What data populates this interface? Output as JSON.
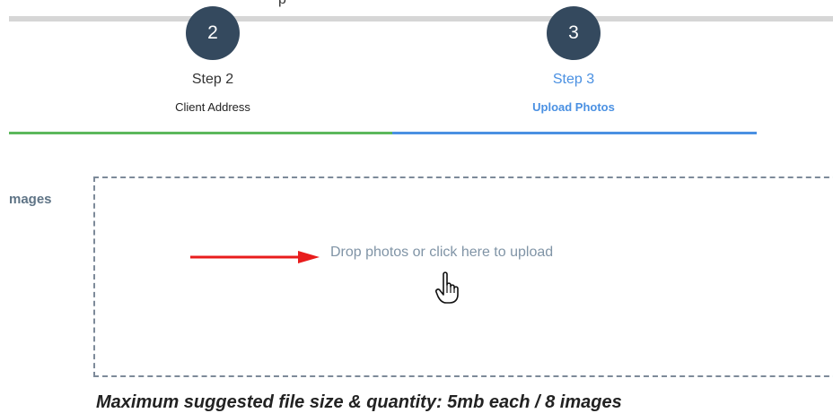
{
  "header": {
    "top_fragment": "p"
  },
  "steps": [
    {
      "number": "2",
      "title": "Step 2",
      "subtitle": "Client Address",
      "state": "done"
    },
    {
      "number": "3",
      "title": "Step 3",
      "subtitle": "Upload Photos",
      "state": "active"
    }
  ],
  "colors": {
    "step_circle": "#34495e",
    "done": "#5cb85c",
    "active": "#4a90e2",
    "arrow": "#e81c1c"
  },
  "upload": {
    "label": "mages",
    "dropzone_text": "Drop photos or click here to upload",
    "hint": "Maximum suggested file size & quantity: 5mb each / 8 images"
  },
  "icons": {
    "arrow": "right-arrow-icon",
    "cursor": "hand-pointer-icon"
  }
}
